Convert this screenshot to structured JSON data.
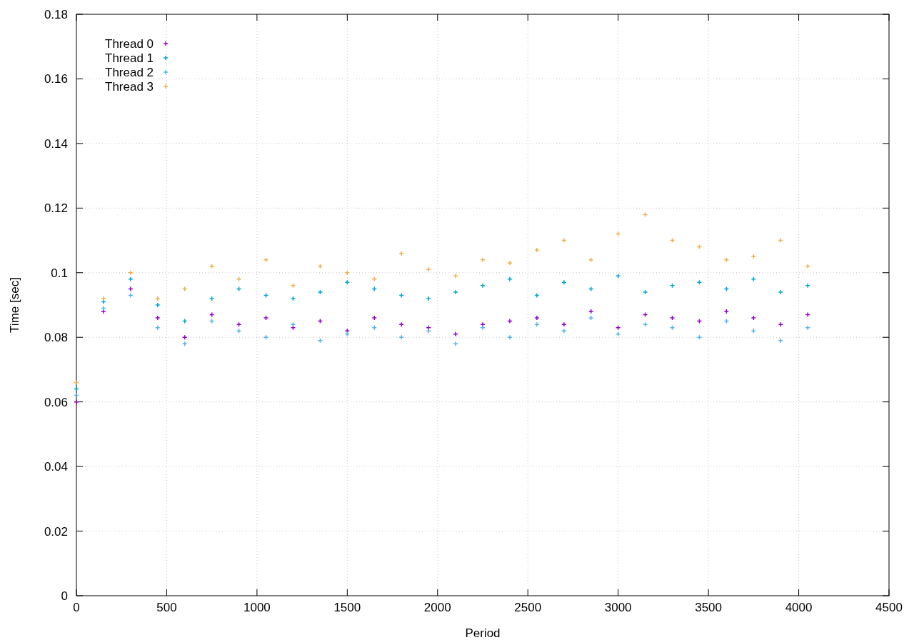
{
  "chart_data": {
    "type": "scatter",
    "grid": true,
    "legend": "upper left",
    "xlabel": "Period",
    "ylabel": "Time [sec]",
    "xlim": [
      0,
      4500
    ],
    "ylim": [
      0,
      0.18
    ],
    "xticks": [
      0,
      500,
      1000,
      1500,
      2000,
      2500,
      3000,
      3500,
      4000,
      4500
    ],
    "yticks": [
      {
        "value": 0,
        "label": "0"
      },
      {
        "value": 0.02,
        "label": "0.02"
      },
      {
        "value": 0.04,
        "label": "0.04"
      },
      {
        "value": 0.06,
        "label": "0.06"
      },
      {
        "value": 0.08,
        "label": "0.08"
      },
      {
        "value": 0.1,
        "label": "0.1"
      },
      {
        "value": 0.12,
        "label": "0.12"
      },
      {
        "value": 0.14,
        "label": "0.14"
      },
      {
        "value": 0.16,
        "label": "0.16"
      },
      {
        "value": 0.18,
        "label": "0.18"
      }
    ],
    "x": [
      0,
      150,
      300,
      450,
      600,
      750,
      900,
      1050,
      1200,
      1350,
      1500,
      1650,
      1800,
      1950,
      2100,
      2250,
      2400,
      2550,
      2700,
      2850,
      3000,
      3150,
      3300,
      3450,
      3600,
      3750,
      3900,
      4050
    ],
    "series": [
      {
        "name": "Thread 0",
        "color": "#9400d3",
        "values": [
          0.06,
          0.088,
          0.095,
          0.086,
          0.08,
          0.087,
          0.084,
          0.086,
          0.083,
          0.085,
          0.082,
          0.086,
          0.084,
          0.083,
          0.081,
          0.084,
          0.085,
          0.086,
          0.084,
          0.088,
          0.083,
          0.087,
          0.086,
          0.085,
          0.088,
          0.086,
          0.084,
          0.087
        ]
      },
      {
        "name": "Thread 1",
        "color": "#00a8d0",
        "values": [
          0.064,
          0.091,
          0.098,
          0.09,
          0.085,
          0.092,
          0.095,
          0.093,
          0.092,
          0.094,
          0.097,
          0.095,
          0.093,
          0.092,
          0.094,
          0.096,
          0.098,
          0.093,
          0.097,
          0.095,
          0.099,
          0.094,
          0.096,
          0.097,
          0.095,
          0.098,
          0.094,
          0.096
        ]
      },
      {
        "name": "Thread 2",
        "color": "#56b4e9",
        "values": [
          0.062,
          0.089,
          0.093,
          0.083,
          0.078,
          0.085,
          0.082,
          0.08,
          0.084,
          0.079,
          0.081,
          0.083,
          0.08,
          0.082,
          0.078,
          0.083,
          0.08,
          0.084,
          0.082,
          0.086,
          0.081,
          0.084,
          0.083,
          0.08,
          0.085,
          0.082,
          0.079,
          0.083
        ]
      },
      {
        "name": "Thread 3",
        "color": "#f0b050",
        "values": [
          0.066,
          0.092,
          0.1,
          0.092,
          0.095,
          0.102,
          0.098,
          0.104,
          0.096,
          0.102,
          0.1,
          0.098,
          0.106,
          0.101,
          0.099,
          0.104,
          0.103,
          0.107,
          0.11,
          0.104,
          0.112,
          0.118,
          0.11,
          0.108,
          0.104,
          0.105,
          0.11,
          0.102
        ]
      }
    ]
  }
}
